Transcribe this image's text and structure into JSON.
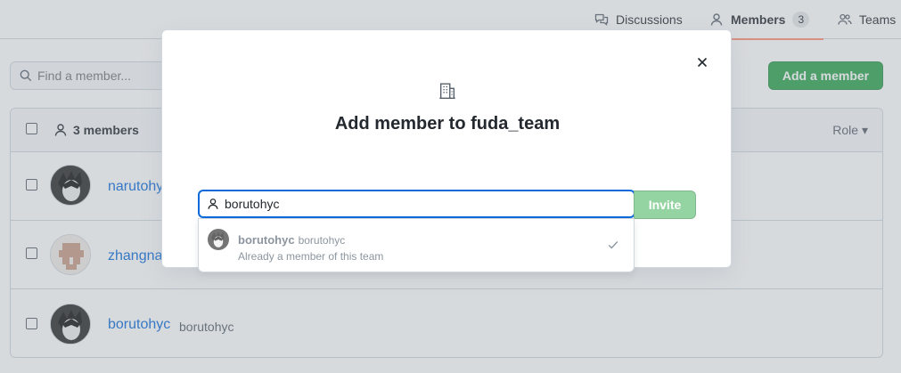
{
  "tabs": [
    {
      "label": "Discussions",
      "icon": "comment-discussion-icon"
    },
    {
      "label": "Members",
      "icon": "person-icon",
      "count": "3"
    },
    {
      "label": "Teams",
      "icon": "people-icon"
    }
  ],
  "find": {
    "placeholder": "Find a member..."
  },
  "add_member_button": "Add a member",
  "members_box": {
    "header_count": "3 members",
    "role_label": "Role",
    "rows": [
      {
        "name": "narutohy",
        "login": ""
      },
      {
        "name": "zhangna",
        "login": ""
      },
      {
        "name": "borutohyc",
        "login": "borutohyc"
      }
    ]
  },
  "dialog": {
    "title": "Add member to fuda_team",
    "search_value": "borutohyc",
    "invite_label": "Invite",
    "suggestion": {
      "name": "borutohyc",
      "login": "borutohyc",
      "note": "Already a member of this team"
    }
  },
  "colors": {
    "accent_blue": "#0969da",
    "green": "#2da44e",
    "tab_underline": "#fd8c73"
  }
}
